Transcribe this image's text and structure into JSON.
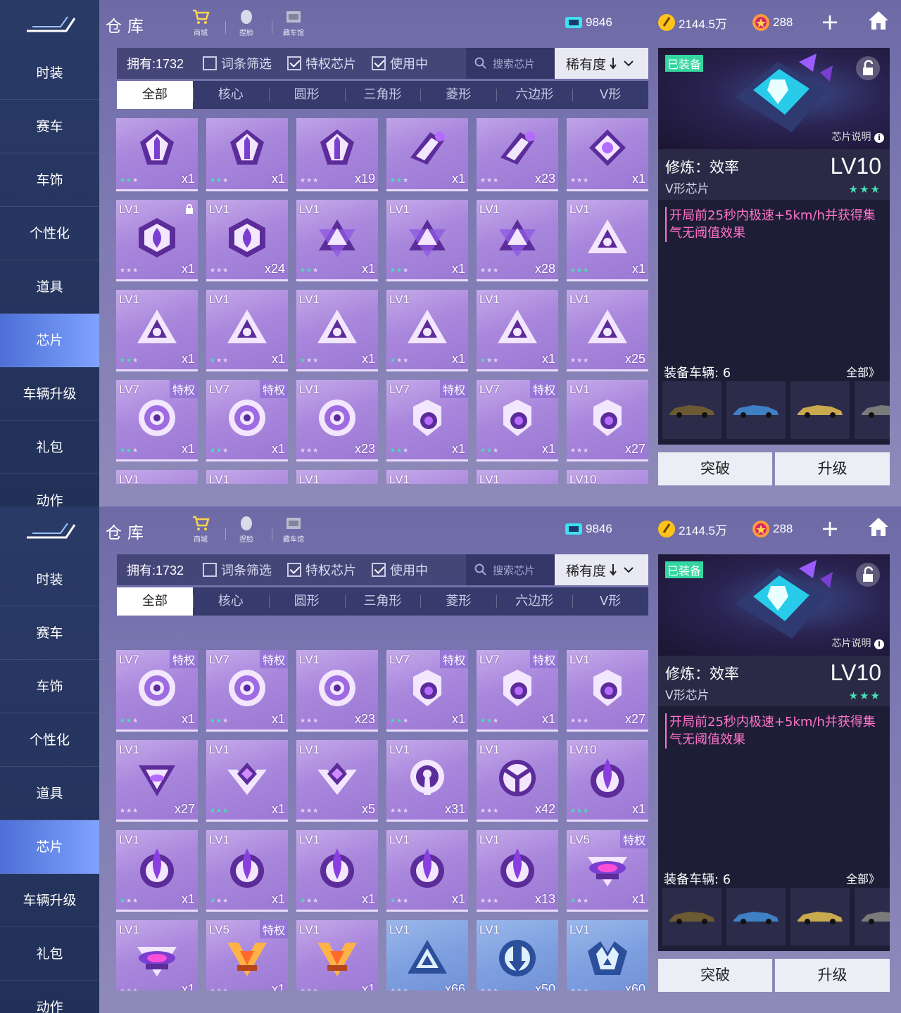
{
  "sidebar": {
    "items": [
      "时装",
      "赛车",
      "车饰",
      "个性化",
      "道具",
      "芯片",
      "车辆升级",
      "礼包",
      "动作"
    ],
    "active_index": 5
  },
  "header": {
    "title": "仓库",
    "shop_label": "商城",
    "face_label": "捏脸",
    "garage_label": "藏车馆",
    "currency1": "9846",
    "currency2": "2144.5万",
    "currency3": "288"
  },
  "filters": {
    "owned": "拥有:1732",
    "entry_filter": "词条筛选",
    "privilege_chip": "特权芯片",
    "in_use": "使用中",
    "search_placeholder": "搜索芯片",
    "sort": "稀有度"
  },
  "tabs": [
    "全部",
    "核心",
    "圆形",
    "三角形",
    "菱形",
    "六边形",
    "V形"
  ],
  "detail": {
    "equipped": "已装备",
    "chip_info": "芯片说明",
    "name": "修炼：效率",
    "type": "V形芯片",
    "level": "LV10",
    "description": "开局前25秒内极速+5km/h并获得集气无阈值效果",
    "vehicles_label": "装备车辆: 6",
    "all_label": "全部》",
    "breakthrough": "突破",
    "upgrade": "升级"
  },
  "accent": "#4d6fd6",
  "special_label": "特权",
  "grid_top": [
    {
      "lv": "",
      "cnt": "x1",
      "stars": 2,
      "icon": "arrow-shield",
      "tq": false
    },
    {
      "lv": "",
      "cnt": "x1",
      "stars": 2,
      "icon": "arrow-shield",
      "tq": false
    },
    {
      "lv": "",
      "cnt": "x19",
      "stars": 0,
      "icon": "arrow-shield",
      "tq": false
    },
    {
      "lv": "",
      "cnt": "x1",
      "stars": 2,
      "icon": "comet",
      "tq": false
    },
    {
      "lv": "",
      "cnt": "x23",
      "stars": 0,
      "icon": "comet",
      "tq": false
    },
    {
      "lv": "",
      "cnt": "x1",
      "stars": 0,
      "icon": "diamond-drop",
      "tq": false
    },
    {
      "lv": "LV1",
      "cnt": "x1",
      "stars": 0,
      "icon": "hex-drop",
      "tq": false,
      "lock": true
    },
    {
      "lv": "LV1",
      "cnt": "x24",
      "stars": 0,
      "icon": "hex-drop",
      "tq": false
    },
    {
      "lv": "LV1",
      "cnt": "x1",
      "stars": 2,
      "icon": "star-tri",
      "tq": false
    },
    {
      "lv": "LV1",
      "cnt": "x1",
      "stars": 2,
      "icon": "star-tri",
      "tq": false
    },
    {
      "lv": "LV1",
      "cnt": "x28",
      "stars": 0,
      "icon": "star-tri",
      "tq": false
    },
    {
      "lv": "LV1",
      "cnt": "x1",
      "stars": 3,
      "icon": "tri-claw",
      "tq": false
    },
    {
      "lv": "LV1",
      "cnt": "x1",
      "stars": 2,
      "icon": "tri-claw",
      "tq": false
    },
    {
      "lv": "LV1",
      "cnt": "x1",
      "stars": 1,
      "icon": "tri-claw",
      "tq": false
    },
    {
      "lv": "LV1",
      "cnt": "x1",
      "stars": 1,
      "icon": "tri-claw",
      "tq": false
    },
    {
      "lv": "LV1",
      "cnt": "x1",
      "stars": 1,
      "icon": "tri-claw",
      "tq": false
    },
    {
      "lv": "LV1",
      "cnt": "x1",
      "stars": 1,
      "icon": "tri-claw",
      "tq": false
    },
    {
      "lv": "LV1",
      "cnt": "x25",
      "stars": 0,
      "icon": "tri-claw",
      "tq": false
    },
    {
      "lv": "LV7",
      "cnt": "x1",
      "stars": 2,
      "icon": "swirl",
      "tq": true
    },
    {
      "lv": "LV7",
      "cnt": "x1",
      "stars": 2,
      "icon": "swirl",
      "tq": true
    },
    {
      "lv": "LV1",
      "cnt": "x23",
      "stars": 0,
      "icon": "swirl",
      "tq": false
    },
    {
      "lv": "LV7",
      "cnt": "x1",
      "stars": 2,
      "icon": "orb-shield",
      "tq": true
    },
    {
      "lv": "LV7",
      "cnt": "x1",
      "stars": 2,
      "icon": "orb-shield",
      "tq": true
    },
    {
      "lv": "LV1",
      "cnt": "x27",
      "stars": 0,
      "icon": "orb-shield",
      "tq": false
    },
    {
      "lv": "LV1",
      "cnt": "",
      "stars": 0,
      "icon": "v-tri",
      "tq": false
    },
    {
      "lv": "LV1",
      "cnt": "",
      "stars": 0,
      "icon": "v-tri",
      "tq": false
    },
    {
      "lv": "LV1",
      "cnt": "",
      "stars": 0,
      "icon": "v-tri",
      "tq": false
    },
    {
      "lv": "LV1",
      "cnt": "",
      "stars": 0,
      "icon": "ring",
      "tq": false
    },
    {
      "lv": "LV1",
      "cnt": "",
      "stars": 0,
      "icon": "ring",
      "tq": false
    },
    {
      "lv": "LV10",
      "cnt": "",
      "stars": 0,
      "icon": "ring",
      "tq": false
    }
  ],
  "grid_bottom": [
    {
      "lv": "LV7",
      "cnt": "x1",
      "stars": 2,
      "icon": "swirl",
      "tq": true
    },
    {
      "lv": "LV7",
      "cnt": "x1",
      "stars": 2,
      "icon": "swirl",
      "tq": true
    },
    {
      "lv": "LV1",
      "cnt": "x23",
      "stars": 0,
      "icon": "swirl",
      "tq": false
    },
    {
      "lv": "LV7",
      "cnt": "x1",
      "stars": 2,
      "icon": "orb-shield",
      "tq": true
    },
    {
      "lv": "LV7",
      "cnt": "x1",
      "stars": 2,
      "icon": "orb-shield",
      "tq": true
    },
    {
      "lv": "LV1",
      "cnt": "x27",
      "stars": 0,
      "icon": "orb-shield",
      "tq": false
    },
    {
      "lv": "LV1",
      "cnt": "x27",
      "stars": 0,
      "icon": "v-tri",
      "tq": false
    },
    {
      "lv": "LV1",
      "cnt": "x1",
      "stars": 3,
      "icon": "v-diamond",
      "tq": false
    },
    {
      "lv": "LV1",
      "cnt": "x5",
      "stars": 0,
      "icon": "v-diamond",
      "tq": false
    },
    {
      "lv": "LV1",
      "cnt": "x31",
      "stars": 0,
      "icon": "keyhole",
      "tq": false
    },
    {
      "lv": "LV1",
      "cnt": "x42",
      "stars": 0,
      "icon": "y-circle",
      "tq": false
    },
    {
      "lv": "LV10",
      "cnt": "x1",
      "stars": 3,
      "icon": "ring-drop",
      "tq": false
    },
    {
      "lv": "LV1",
      "cnt": "x1",
      "stars": 1,
      "icon": "ring-drop",
      "tq": false
    },
    {
      "lv": "LV1",
      "cnt": "x1",
      "stars": 1,
      "icon": "ring-drop",
      "tq": false
    },
    {
      "lv": "LV1",
      "cnt": "x1",
      "stars": 1,
      "icon": "ring-drop",
      "tq": false
    },
    {
      "lv": "LV1",
      "cnt": "x1",
      "stars": 1,
      "icon": "ring-drop",
      "tq": false
    },
    {
      "lv": "LV1",
      "cnt": "x13",
      "stars": 0,
      "icon": "ring-drop",
      "tq": false
    },
    {
      "lv": "LV5",
      "cnt": "x1",
      "stars": 1,
      "icon": "wing-badge",
      "tq": true
    },
    {
      "lv": "LV1",
      "cnt": "x1",
      "stars": 0,
      "icon": "wing-badge",
      "tq": false
    },
    {
      "lv": "LV5",
      "cnt": "x1",
      "stars": 0,
      "icon": "gold-v",
      "tq": true
    },
    {
      "lv": "LV1",
      "cnt": "x1",
      "stars": 0,
      "icon": "gold-v",
      "tq": false
    },
    {
      "lv": "LV1",
      "cnt": "x66",
      "stars": 0,
      "icon": "blue-tri",
      "tq": false,
      "blue": true
    },
    {
      "lv": "LV1",
      "cnt": "x50",
      "stars": 0,
      "icon": "blue-down",
      "tq": false,
      "blue": true
    },
    {
      "lv": "LV1",
      "cnt": "x60",
      "stars": 0,
      "icon": "blue-m",
      "tq": false,
      "blue": true
    }
  ]
}
